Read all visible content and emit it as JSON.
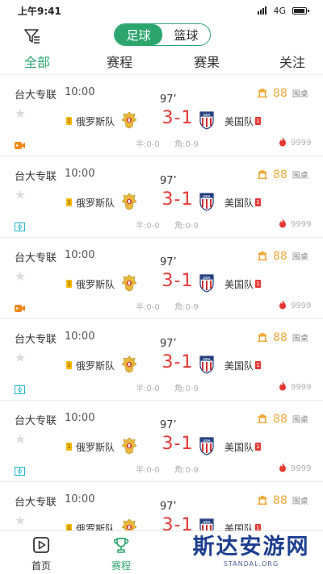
{
  "status_bar": {
    "time": "上午9:41",
    "network": "4G"
  },
  "header": {
    "sport_tabs": [
      {
        "label": "足球",
        "active": true
      },
      {
        "label": "篮球",
        "active": false
      }
    ]
  },
  "tabs": [
    {
      "label": "全部",
      "active": true
    },
    {
      "label": "赛程",
      "active": false
    },
    {
      "label": "赛果",
      "active": false
    },
    {
      "label": "关注",
      "active": false
    }
  ],
  "colors": {
    "accent": "#2da66e",
    "score": "#e53935",
    "bet": "#f0a83a"
  },
  "matches": [
    {
      "league": "台大专联",
      "time": "10:00",
      "minute": "97’",
      "home": "俄罗斯队",
      "away": "美国队",
      "home_yellow": "1",
      "away_red": "1",
      "score": "3-1",
      "half": "半:0-0",
      "corner": "角:0-9",
      "bet_count": "88",
      "bet_label": "围桌",
      "heat": "9999",
      "media": "video-icon"
    },
    {
      "league": "台大专联",
      "time": "10:00",
      "minute": "97’",
      "home": "俄罗斯队",
      "away": "美国队",
      "home_yellow": "1",
      "away_red": "1",
      "score": "3-1",
      "half": "半:0-0",
      "corner": "角:0-9",
      "bet_count": "88",
      "bet_label": "围桌",
      "heat": "9999",
      "media": "animation-icon"
    },
    {
      "league": "台大专联",
      "time": "10:00",
      "minute": "97’",
      "home": "俄罗斯队",
      "away": "美国队",
      "home_yellow": "1",
      "away_red": "1",
      "score": "3-1",
      "half": "半:0-0",
      "corner": "角:0-9",
      "bet_count": "88",
      "bet_label": "围桌",
      "heat": "9999",
      "media": "video-icon"
    },
    {
      "league": "台大专联",
      "time": "10:00",
      "minute": "97’",
      "home": "俄罗斯队",
      "away": "美国队",
      "home_yellow": "1",
      "away_red": "1",
      "score": "3-1",
      "half": "半:0-0",
      "corner": "角:0-9",
      "bet_count": "88",
      "bet_label": "围桌",
      "heat": "9999",
      "media": "animation-icon"
    },
    {
      "league": "台大专联",
      "time": "10:00",
      "minute": "97’",
      "home": "俄罗斯队",
      "away": "美国队",
      "home_yellow": "1",
      "away_red": "1",
      "score": "3-1",
      "half": "半:0-0",
      "corner": "角:0-9",
      "bet_count": "88",
      "bet_label": "围桌",
      "heat": "9999",
      "media": "animation-icon"
    },
    {
      "league": "台大专联",
      "time": "10:00",
      "minute": "97’",
      "home": "俄罗斯队",
      "away": "美国队",
      "home_yellow": "1",
      "away_red": "1",
      "score": "3-1",
      "half": "",
      "corner": "",
      "bet_count": "88",
      "bet_label": "围桌",
      "heat": "",
      "media": ""
    }
  ],
  "bottom_nav": [
    {
      "label": "首页",
      "icon": "play-icon",
      "active": false
    },
    {
      "label": "赛程",
      "icon": "trophy-icon",
      "active": true
    }
  ],
  "watermark": {
    "main": "斯达安游网",
    "sub": "STANDAL.ORG"
  }
}
